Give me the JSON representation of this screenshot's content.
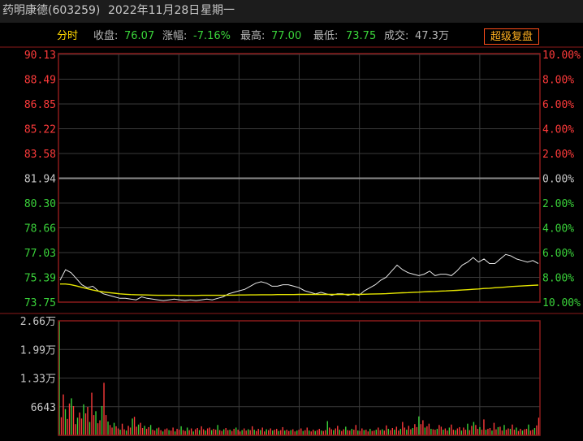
{
  "title": {
    "stock_name": "药明康德(603259)",
    "date": "2022年11月28日",
    "weekday": "星期一"
  },
  "info": {
    "mode_label": "分时",
    "close_label": "收盘:",
    "close_value": "76.07",
    "change_label": "涨幅:",
    "change_value": "-7.16%",
    "high_label": "最高:",
    "high_value": "77.00",
    "low_label": "最低:",
    "low_value": "73.75",
    "volume_label": "成交:",
    "volume_value": "47.3万",
    "super_button": "超级复盘"
  },
  "colors": {
    "up": "#ff3b3b",
    "down": "#3ad33a",
    "neutral": "#c8c8c8",
    "price_line": "#e8e8e8",
    "avg_line": "#e6e600",
    "grid": "#3a3a3a",
    "border": "#8b1a1a"
  },
  "chart_data": [
    {
      "type": "line",
      "name_role": "intraday price chart",
      "prev_close": 81.94,
      "ylim": [
        73.75,
        90.13
      ],
      "y_tick_labels": [
        "90.13",
        "88.49",
        "86.85",
        "85.22",
        "83.58",
        "81.94",
        "80.30",
        "78.66",
        "77.03",
        "75.39",
        "73.75"
      ],
      "right_tick_labels": [
        "10.00%",
        "8.00%",
        "6.00%",
        "4.00%",
        "2.00%",
        "0.00%",
        "2.00%",
        "4.00%",
        "6.00%",
        "8.00%",
        "10.00%"
      ],
      "series": [
        {
          "role": "price",
          "values": [
            75.2,
            75.9,
            75.7,
            75.3,
            74.9,
            74.7,
            74.8,
            74.5,
            74.3,
            74.2,
            74.1,
            74.0,
            74.0,
            73.95,
            73.9,
            74.1,
            74.0,
            73.95,
            73.9,
            73.85,
            73.9,
            73.95,
            73.9,
            73.85,
            73.9,
            73.85,
            73.9,
            73.95,
            73.9,
            74.0,
            74.1,
            74.3,
            74.4,
            74.5,
            74.6,
            74.8,
            75.0,
            75.1,
            75.0,
            74.8,
            74.8,
            74.9,
            74.9,
            74.8,
            74.7,
            74.5,
            74.4,
            74.3,
            74.4,
            74.3,
            74.2,
            74.3,
            74.3,
            74.2,
            74.3,
            74.2,
            74.5,
            74.7,
            74.9,
            75.2,
            75.4,
            75.8,
            76.2,
            75.9,
            75.7,
            75.6,
            75.5,
            75.6,
            75.8,
            75.5,
            75.6,
            75.6,
            75.5,
            75.8,
            76.2,
            76.4,
            76.7,
            76.4,
            76.6,
            76.3,
            76.3,
            76.6,
            76.9,
            76.8,
            76.6,
            76.5,
            76.4,
            76.5,
            76.3
          ]
        },
        {
          "role": "average",
          "values": [
            74.95,
            74.95,
            74.9,
            74.82,
            74.73,
            74.64,
            74.55,
            74.48,
            74.42,
            74.38,
            74.34,
            74.3,
            74.27,
            74.25,
            74.24,
            74.23,
            74.22,
            74.21,
            74.2,
            74.2,
            74.2,
            74.2,
            74.19,
            74.19,
            74.19,
            74.19,
            74.2,
            74.2,
            74.2,
            74.2,
            74.2,
            74.21,
            74.21,
            74.22,
            74.22,
            74.23,
            74.23,
            74.24,
            74.24,
            74.24,
            74.25,
            74.25,
            74.25,
            74.25,
            74.26,
            74.26,
            74.26,
            74.26,
            74.26,
            74.26,
            74.26,
            74.26,
            74.26,
            74.26,
            74.26,
            74.26,
            74.27,
            74.28,
            74.29,
            74.3,
            74.31,
            74.33,
            74.35,
            74.37,
            74.38,
            74.4,
            74.41,
            74.43,
            74.45,
            74.46,
            74.48,
            74.49,
            74.51,
            74.53,
            74.55,
            74.57,
            74.6,
            74.62,
            74.65,
            74.67,
            74.7,
            74.72,
            74.75,
            74.78,
            74.8,
            74.82,
            74.84,
            74.86,
            74.88
          ]
        }
      ]
    },
    {
      "type": "bar",
      "name_role": "volume chart",
      "ylim": [
        0,
        26600
      ],
      "y_tick_labels": [
        "2.66万",
        "1.99万",
        "1.33万",
        "6643"
      ],
      "values": [
        26600,
        4200,
        9500,
        6100,
        3800,
        7400,
        8600,
        6800,
        2600,
        4100,
        5300,
        3900,
        7200,
        5100,
        6600,
        3100,
        9900,
        4700,
        5600,
        2800,
        3500,
        6800,
        12200,
        4700,
        3200,
        2400,
        1800,
        2900,
        2100,
        1600,
        1300,
        2700,
        1400,
        1100,
        2200,
        1800,
        3900,
        4300,
        2000,
        2500,
        2900,
        1700,
        2200,
        1500,
        1900,
        2400,
        1300,
        1100,
        1600,
        1800,
        1200,
        900,
        1400,
        1600,
        1200,
        1100,
        1800,
        900,
        1500,
        1300,
        2100,
        1200,
        1000,
        1800,
        1200,
        1600,
        900,
        1400,
        1700,
        1200,
        2100,
        1400,
        1100,
        1600,
        1800,
        1200,
        1500,
        1300,
        2400,
        1200,
        1000,
        1400,
        1700,
        1200,
        1300,
        1000,
        1500,
        1800,
        1300,
        900,
        1200,
        1600,
        1100,
        1400,
        1200,
        2100,
        1300,
        1000,
        1500,
        1200,
        1800,
        900,
        1400,
        1200,
        1600,
        1100,
        1300,
        1500,
        1000,
        1200,
        1900,
        1100,
        1300,
        1000,
        1200,
        1400,
        900,
        1100,
        1300,
        1600,
        1000,
        1200,
        1800,
        1100,
        900,
        1300,
        1000,
        1200,
        1500,
        1100,
        1000,
        1200,
        3300,
        1800,
        1400,
        1200,
        1600,
        2200,
        1300,
        1000,
        1400,
        2000,
        1200,
        1100,
        1500,
        1300,
        2400,
        1100,
        1000,
        1600,
        1200,
        1300,
        900,
        1500,
        1000,
        1100,
        1300,
        1800,
        1200,
        1400,
        1100,
        2300,
        1500,
        1200,
        1700,
        1300,
        2000,
        1100,
        1500,
        3100,
        1800,
        1300,
        2200,
        1400,
        1700,
        2600,
        1900,
        4400,
        2600,
        3500,
        1800,
        2100,
        2700,
        1500,
        1400,
        1300,
        1500,
        2400,
        2000,
        1300,
        1600,
        1100,
        1800,
        2500,
        1300,
        1200,
        1600,
        1900,
        1100,
        1800,
        1300,
        2700,
        1200,
        2200,
        3100,
        2400,
        1500,
        1900,
        1300,
        3700,
        1300,
        1500,
        1700,
        1100,
        2900,
        1400,
        1900,
        2000,
        1100,
        2400,
        1300,
        1600,
        1500,
        2500,
        1300,
        1800,
        1000,
        1500,
        1100,
        1400,
        1500,
        2500,
        1100,
        1300,
        1700,
        2300,
        4100
      ]
    }
  ]
}
